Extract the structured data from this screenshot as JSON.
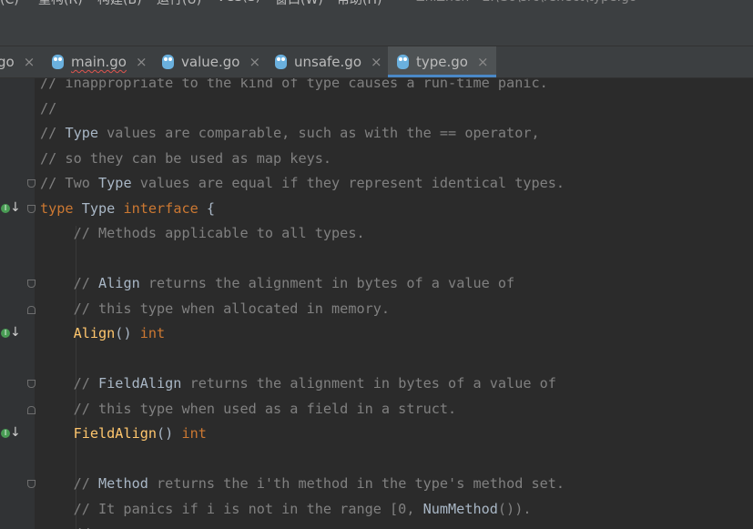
{
  "menu": {
    "items": [
      "码(C)",
      "重构(R)",
      "构建(B)",
      "运行(U)",
      "VCS(S)",
      "窗口(W)",
      "帮助(H)"
    ],
    "window_title": "ZhiZhen - E:\\Go\\src\\reflect\\type.go"
  },
  "tabs": [
    {
      "label": "go",
      "active": false,
      "error": false,
      "icon": "go-file-icon"
    },
    {
      "label": "main.go",
      "active": false,
      "error": true,
      "icon": "go-file-icon"
    },
    {
      "label": "value.go",
      "active": false,
      "error": false,
      "icon": "go-file-icon"
    },
    {
      "label": "unsafe.go",
      "active": false,
      "error": false,
      "icon": "go-file-icon"
    },
    {
      "label": "type.go",
      "active": true,
      "error": false,
      "icon": "go-file-icon"
    }
  ],
  "tab_close_glyph": "×",
  "colors": {
    "comment": "#808080",
    "keyword": "#cc7832",
    "function": "#ffc66d",
    "text": "#a9b7c6",
    "background": "#2b2b2b",
    "active_tab_underline": "#4a88c7",
    "implementation_marker": "#499c54"
  },
  "code_lines": [
    [
      {
        "t": "// inappropriate to the kind of type causes a run-time panic.",
        "k": "c"
      }
    ],
    [
      {
        "t": "//",
        "k": "c"
      }
    ],
    [
      {
        "t": "// ",
        "k": "c"
      },
      {
        "t": "Type",
        "k": "ty"
      },
      {
        "t": " values are comparable, such as with the == operator,",
        "k": "c"
      }
    ],
    [
      {
        "t": "// so they can be used as map keys.",
        "k": "c"
      }
    ],
    [
      {
        "t": "// Two ",
        "k": "c"
      },
      {
        "t": "Type",
        "k": "ty"
      },
      {
        "t": " values are equal if they represent identical types.",
        "k": "c"
      }
    ],
    [
      {
        "t": "type",
        "k": "kw"
      },
      {
        "t": " Type ",
        "k": "ty"
      },
      {
        "t": "interface",
        "k": "kw"
      },
      {
        "t": " {",
        "k": "ty"
      }
    ],
    [
      {
        "t": "    // Methods applicable to all types.",
        "k": "c"
      }
    ],
    [],
    [
      {
        "t": "    // ",
        "k": "c"
      },
      {
        "t": "Align",
        "k": "ty"
      },
      {
        "t": " returns the alignment in bytes of a value of",
        "k": "c"
      }
    ],
    [
      {
        "t": "    // this type when allocated in memory.",
        "k": "c"
      }
    ],
    [
      {
        "t": "    ",
        "k": "ty"
      },
      {
        "t": "Align",
        "k": "fn"
      },
      {
        "t": "() ",
        "k": "ty"
      },
      {
        "t": "int",
        "k": "kw"
      }
    ],
    [],
    [
      {
        "t": "    // ",
        "k": "c"
      },
      {
        "t": "FieldAlign",
        "k": "ty"
      },
      {
        "t": " returns the alignment in bytes of a value of",
        "k": "c"
      }
    ],
    [
      {
        "t": "    // this type when used as a field in a struct.",
        "k": "c"
      }
    ],
    [
      {
        "t": "    ",
        "k": "ty"
      },
      {
        "t": "FieldAlign",
        "k": "fn"
      },
      {
        "t": "() ",
        "k": "ty"
      },
      {
        "t": "int",
        "k": "kw"
      }
    ],
    [],
    [
      {
        "t": "    // ",
        "k": "c"
      },
      {
        "t": "Method",
        "k": "ty"
      },
      {
        "t": " returns the i'th method in the type's method set.",
        "k": "c"
      }
    ],
    [
      {
        "t": "    // It panics if i is not in the range [0, ",
        "k": "c"
      },
      {
        "t": "NumMethod",
        "k": "ty"
      },
      {
        "t": "()).",
        "k": "c"
      }
    ],
    [
      {
        "t": "    //",
        "k": "c"
      }
    ]
  ],
  "gutter": {
    "impl_markers_lines": [
      5,
      10,
      14
    ],
    "impl_marker_letter": "I",
    "impl_marker_arrow": "↓",
    "fold_top_lines": [
      4,
      5,
      8,
      12,
      16
    ],
    "fold_bot_lines": [
      9,
      13
    ]
  }
}
